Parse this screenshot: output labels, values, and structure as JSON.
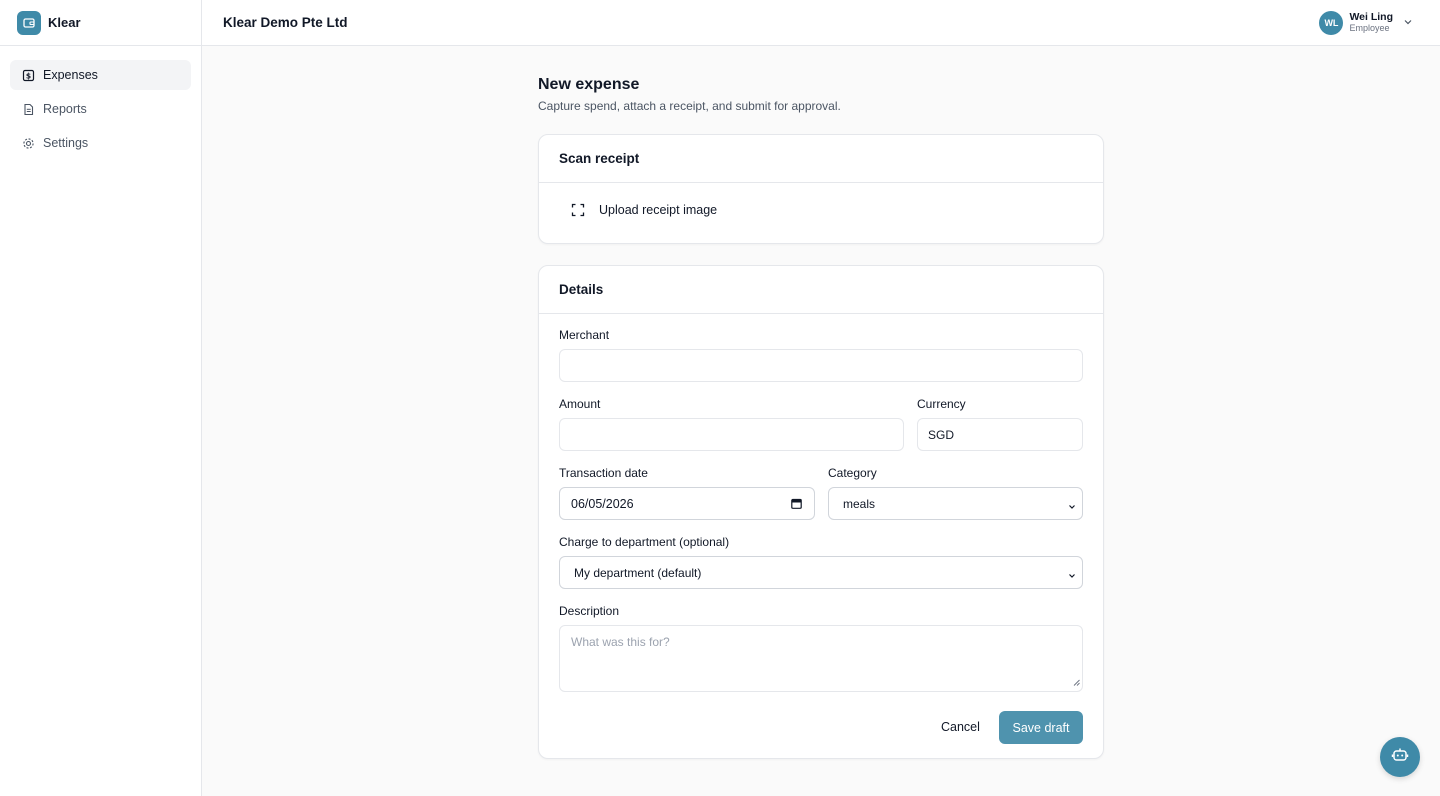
{
  "brand": {
    "name": "Klear",
    "icon": "wallet-icon"
  },
  "sidebar": {
    "items": [
      {
        "label": "Expenses",
        "icon": "dollar-receipt-icon",
        "active": true
      },
      {
        "label": "Reports",
        "icon": "document-icon",
        "active": false
      },
      {
        "label": "Settings",
        "icon": "gear-icon",
        "active": false
      }
    ]
  },
  "header": {
    "company": "Klear Demo Pte Ltd",
    "user": {
      "initials": "WL",
      "name": "Wei Ling",
      "role": "Employee"
    }
  },
  "page": {
    "title": "New expense",
    "subtitle": "Capture spend, attach a receipt, and submit for approval."
  },
  "scan": {
    "title": "Scan receipt",
    "upload_label": "Upload receipt image"
  },
  "details": {
    "title": "Details",
    "merchant": {
      "label": "Merchant",
      "value": ""
    },
    "amount": {
      "label": "Amount",
      "value": ""
    },
    "currency": {
      "label": "Currency",
      "value": "SGD"
    },
    "date": {
      "label": "Transaction date",
      "value": "06/05/2026"
    },
    "category": {
      "label": "Category",
      "value": "meals"
    },
    "department": {
      "label": "Charge to department (optional)",
      "value": "My department (default)"
    },
    "description": {
      "label": "Description",
      "placeholder": "What was this for?"
    },
    "cancel_label": "Cancel",
    "save_label": "Save draft"
  },
  "colors": {
    "accent": "#3f8aa8",
    "button": "#4f93ae",
    "border": "#e5e7eb"
  }
}
